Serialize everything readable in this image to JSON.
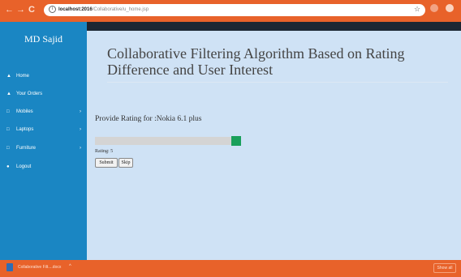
{
  "browser": {
    "url_host": "localhost:2016",
    "url_path": "/Collaborative/u_home.jsp",
    "back_icon": "←",
    "forward_icon": "→",
    "reload_icon": "C",
    "info_icon": "i",
    "star_icon": "☆"
  },
  "sidebar": {
    "user_name": "MD Sajid",
    "items": [
      {
        "label": "Home",
        "icon": "home-icon"
      },
      {
        "label": "Your Orders",
        "icon": "home-icon"
      },
      {
        "label": "Mobiles",
        "icon": "file-icon",
        "caret": "›"
      },
      {
        "label": "Laptops",
        "icon": "file-icon",
        "caret": "›"
      },
      {
        "label": "Furniture",
        "icon": "file-icon",
        "caret": "›"
      },
      {
        "label": "Logout",
        "icon": "user-icon"
      }
    ]
  },
  "main": {
    "title": "Collaborative Filtering Algorithm Based on Rating Difference and User Interest",
    "prompt_prefix": "Provide Rating for :",
    "product": "Nokia 6.1 plus",
    "rating_text": "Rating: 5",
    "rating_value": 5,
    "submit_label": "Submit",
    "skip_label": "Skip"
  },
  "downloads": {
    "file_name": "Collaborative Filt....docx",
    "caret": "^",
    "show_all_label": "Show all"
  },
  "colors": {
    "browser_bar": "#e8622a",
    "sidebar": "#1a86c3",
    "main_bg": "#cfe2f5",
    "slider_handle": "#1aa05b"
  }
}
